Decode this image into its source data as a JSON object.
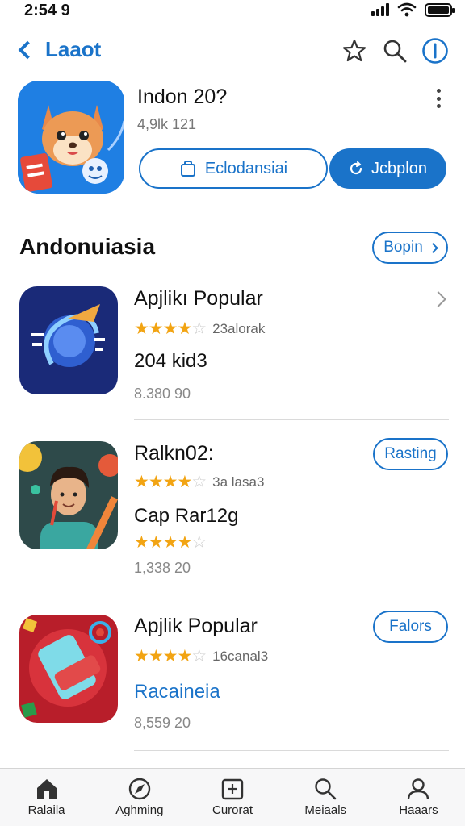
{
  "status": {
    "time": "2:54 9"
  },
  "nav": {
    "back_label": "Laaot"
  },
  "featured": {
    "title": "Indon 20?",
    "subtitle": "4,9lk 121",
    "button_outline": "Eclodansiai",
    "button_solid": "Jcbplon"
  },
  "section": {
    "title": "Andonuiasia",
    "action": "Bopin"
  },
  "apps": [
    {
      "title": "Apjlikı Popular",
      "rating": 4,
      "count": "23alorak",
      "subtitle": "204 kid3",
      "subtitle2": "",
      "price": "8.380 90",
      "action": ""
    },
    {
      "title": "Ralkn02:",
      "rating": 4,
      "count": "3a lasa3",
      "subtitle": "Cap Rar12g",
      "subtitle2": "",
      "price": "1,338 20",
      "action": "Rasting"
    },
    {
      "title": "Apjlik Popular",
      "rating": 4,
      "count": "16canal3",
      "subtitle": "Racaineia",
      "subtitle2": "",
      "price": "8,559 20",
      "action": "Falors"
    }
  ],
  "tabs": [
    {
      "label": "Ralaila",
      "icon": "home-icon"
    },
    {
      "label": "Aghming",
      "icon": "compass-icon"
    },
    {
      "label": "Curorat",
      "icon": "calendar-icon"
    },
    {
      "label": "Meiaals",
      "icon": "search-icon"
    },
    {
      "label": "Haaars",
      "icon": "person-icon"
    }
  ],
  "colors": {
    "accent": "#1a73c9",
    "star": "#f2a413",
    "text": "#111111"
  }
}
